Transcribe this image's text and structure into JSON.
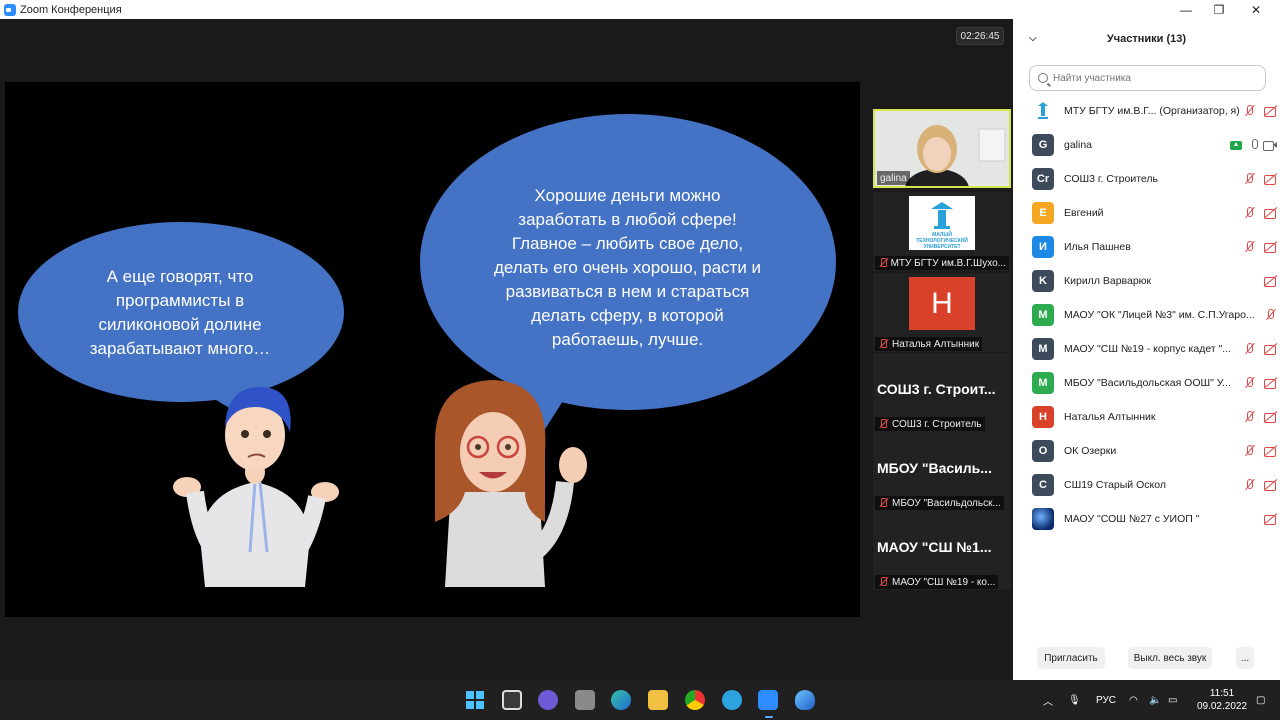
{
  "window": {
    "title": "Zoom Конференция"
  },
  "meeting": {
    "timer": "02:26:45"
  },
  "slide": {
    "left_bubble": [
      "А еще говорят, что",
      "программисты в",
      "силиконовой долине",
      "зарабатывают много…"
    ],
    "right_bubble": [
      "Хорошие деньги можно",
      "заработать в любой сфере!",
      "Главное – любить свое дело,",
      "делать его очень хорошо, расти и",
      "развиваться в нем и стараться",
      "делать сферу, в которой",
      "работаешь, лучше."
    ]
  },
  "thumbnails": [
    {
      "label": "galina",
      "muted": false
    },
    {
      "label": "МТУ БГТУ им.В.Г.Шухо...",
      "muted": true,
      "logo_text": "МАЛЫЙ ТЕХНОЛОГИЧЕСКИЙ УНИВЕРСИТЕТ"
    },
    {
      "label": "Наталья Алтынник",
      "muted": true,
      "avatar_letter": "Н"
    },
    {
      "label": "СОШ3 г. Строитель",
      "muted": true,
      "big_name": "СОШ3 г. Строит..."
    },
    {
      "label": "МБОУ \"Васильдольск...",
      "muted": true,
      "big_name": "МБОУ  \"Василь..."
    },
    {
      "label": "МАОУ \"СШ №19 - ко...",
      "muted": true,
      "big_name": "МАОУ  \"СШ №1..."
    }
  ],
  "panel": {
    "title": "Участники (13)",
    "search_placeholder": "Найти участника",
    "participants": [
      {
        "letter": "",
        "color": "#ffffff",
        "name": "МТУ БГТУ им.В.Г... (Организатор, я)",
        "mic": "off",
        "cam": "off",
        "logo": true
      },
      {
        "letter": "G",
        "color": "#3c4a5c",
        "name": "galina",
        "mic": "on",
        "cam": "on",
        "sharing": true
      },
      {
        "letter": "Cr",
        "color": "#3c4a5c",
        "name": "СОШ3 г. Строитель",
        "mic": "off",
        "cam": "off"
      },
      {
        "letter": "E",
        "color": "#f5a623",
        "name": "Евгений",
        "mic": "off",
        "cam": "off"
      },
      {
        "letter": "И",
        "color": "#1e88e5",
        "name": "Илья Пашнев",
        "mic": "off",
        "cam": "off"
      },
      {
        "letter": "K",
        "color": "#3c4a5c",
        "name": "Кирилл Варварюк",
        "mic": "none",
        "cam": "off"
      },
      {
        "letter": "M",
        "color": "#2eaa4f",
        "name": "МАОУ \"ОК \"Лицей №3\" им. С.П.Угаро...",
        "mic": "off",
        "cam": "none"
      },
      {
        "letter": "M",
        "color": "#3c4a5c",
        "name": "МАОУ \"СШ №19 - корпус кадет \"...",
        "mic": "off",
        "cam": "off"
      },
      {
        "letter": "M",
        "color": "#2eaa4f",
        "name": "МБОУ \"Васильдольская ООШ\" У...",
        "mic": "off",
        "cam": "off"
      },
      {
        "letter": "Н",
        "color": "#d9412b",
        "name": "Наталья Алтынник",
        "mic": "off",
        "cam": "off"
      },
      {
        "letter": "O",
        "color": "#3c4a5c",
        "name": "ОК Озерки",
        "mic": "off",
        "cam": "off"
      },
      {
        "letter": "C",
        "color": "#3c4a5c",
        "name": "СШ19 Старый Оскол",
        "mic": "off",
        "cam": "off"
      },
      {
        "letter": "",
        "color": "#0a2a6a",
        "name": "МАОУ \"СОШ №27 с УИОП \"",
        "mic": "none",
        "cam": "off",
        "planet": true
      }
    ],
    "invite_label": "Пригласить",
    "mute_all_label": "Выкл. весь звук",
    "more_label": "..."
  },
  "taskbar": {
    "lang": "РУС",
    "time": "11:51",
    "date": "09.02.2022"
  }
}
